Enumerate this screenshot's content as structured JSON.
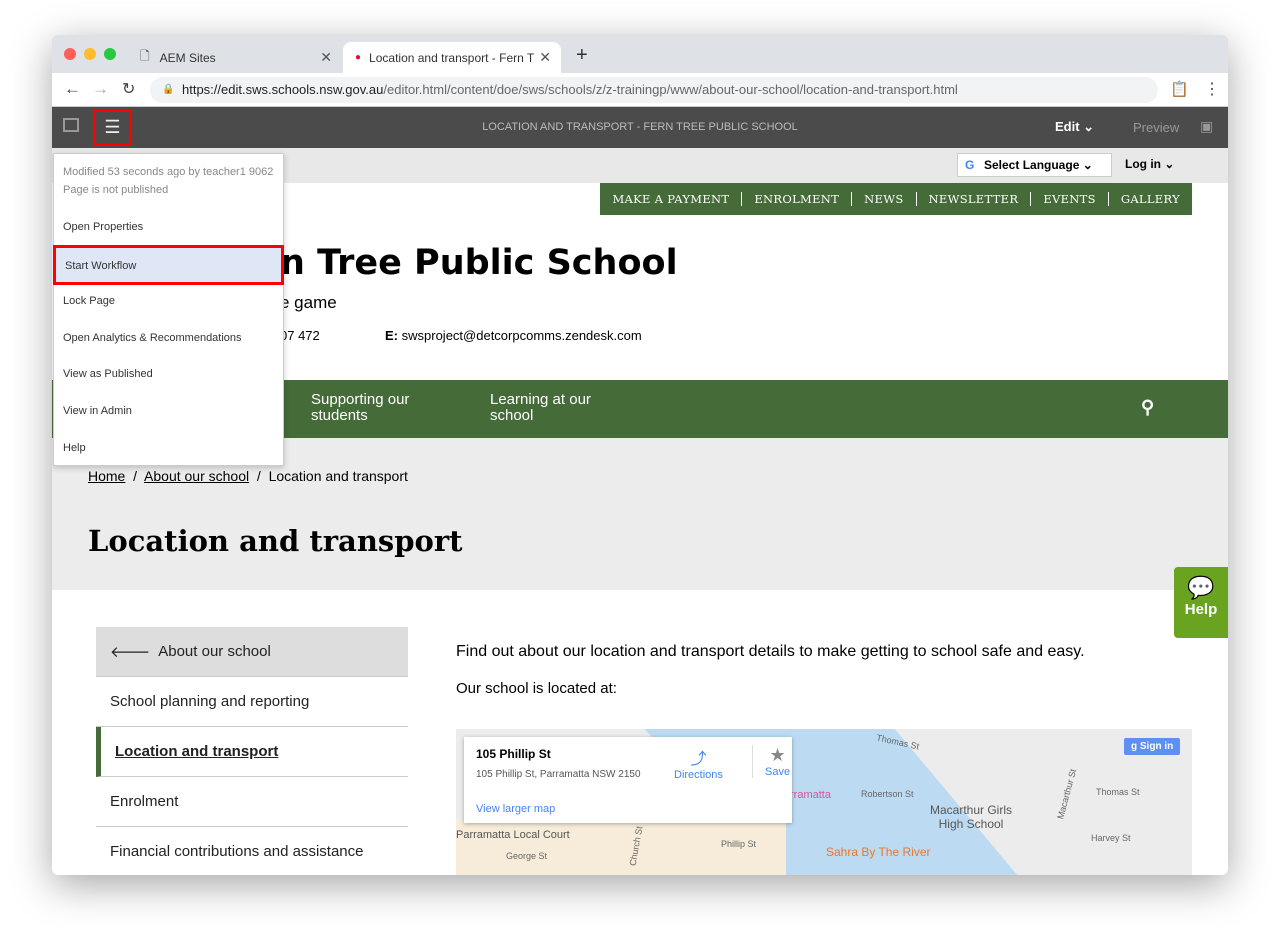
{
  "browser": {
    "tabs": [
      {
        "title": "AEM Sites"
      },
      {
        "title": "Location and transport - Fern T"
      }
    ],
    "url_host": "https://edit.sws.schools.nsw.gov.au",
    "url_path": "/editor.html/content/doe/sws/schools/z/z-trainingp/www/about-our-school/location-and-transport.html"
  },
  "aem": {
    "page_title": "LOCATION AND TRANSPORT - FERN TREE PUBLIC SCHOOL",
    "edit_label": "Edit",
    "preview_label": "Preview"
  },
  "page_menu": {
    "modified": "Modified 53 seconds ago by teacher1 9062",
    "status": "Page is not published",
    "items": [
      "Open Properties",
      "Start Workflow",
      "Lock Page",
      "Open Analytics & Recommendations",
      "View as Published",
      "View in Admin",
      "Help"
    ],
    "highlighted": "Start Workflow"
  },
  "utility": {
    "language": "Select Language",
    "login": "Log in"
  },
  "topnav": [
    "MAKE A PAYMENT",
    "ENROLMENT",
    "NEWS",
    "NEWSLETTER",
    "EVENTS",
    "GALLERY"
  ],
  "school": {
    "name_visible": "n Tree Public School",
    "tagline_visible": "e game",
    "phone_visible": "07 472",
    "email_label": "E:",
    "email": "swsproject@detcorpcomms.zendesk.com"
  },
  "mainnav": [
    "Supporting our students",
    "Learning at our school"
  ],
  "breadcrumb": [
    "Home",
    "About our school",
    "Location and transport"
  ],
  "page_heading": "Location and transport",
  "sidebar": {
    "back": "About our school",
    "items": [
      "School planning and reporting",
      "Location and transport",
      "Enrolment",
      "Financial contributions and assistance"
    ],
    "active": "Location and transport"
  },
  "content": {
    "intro": "Find out about our location and transport details to make getting to school safe and easy.",
    "located": "Our school is located at:"
  },
  "map": {
    "place": "105 Phillip St",
    "address": "105 Phillip St, Parramatta NSW 2150",
    "directions": "Directions",
    "save": "Save",
    "larger": "View larger map",
    "signin": "Sign in",
    "labels": [
      "Thomas St",
      "Robertson St",
      "Macarthur Girls High School",
      "Macarthur St",
      "Harvey St",
      "Parramatta Local Court",
      "Phillip St",
      "George St",
      "Church St",
      "Sahra By The River",
      "rramatta"
    ]
  },
  "help_widget": "Help",
  "colors": {
    "green": "#446b38",
    "help_green": "#6aa31f",
    "highlight": "#dfe6f5",
    "annotation": "#ff0000"
  }
}
